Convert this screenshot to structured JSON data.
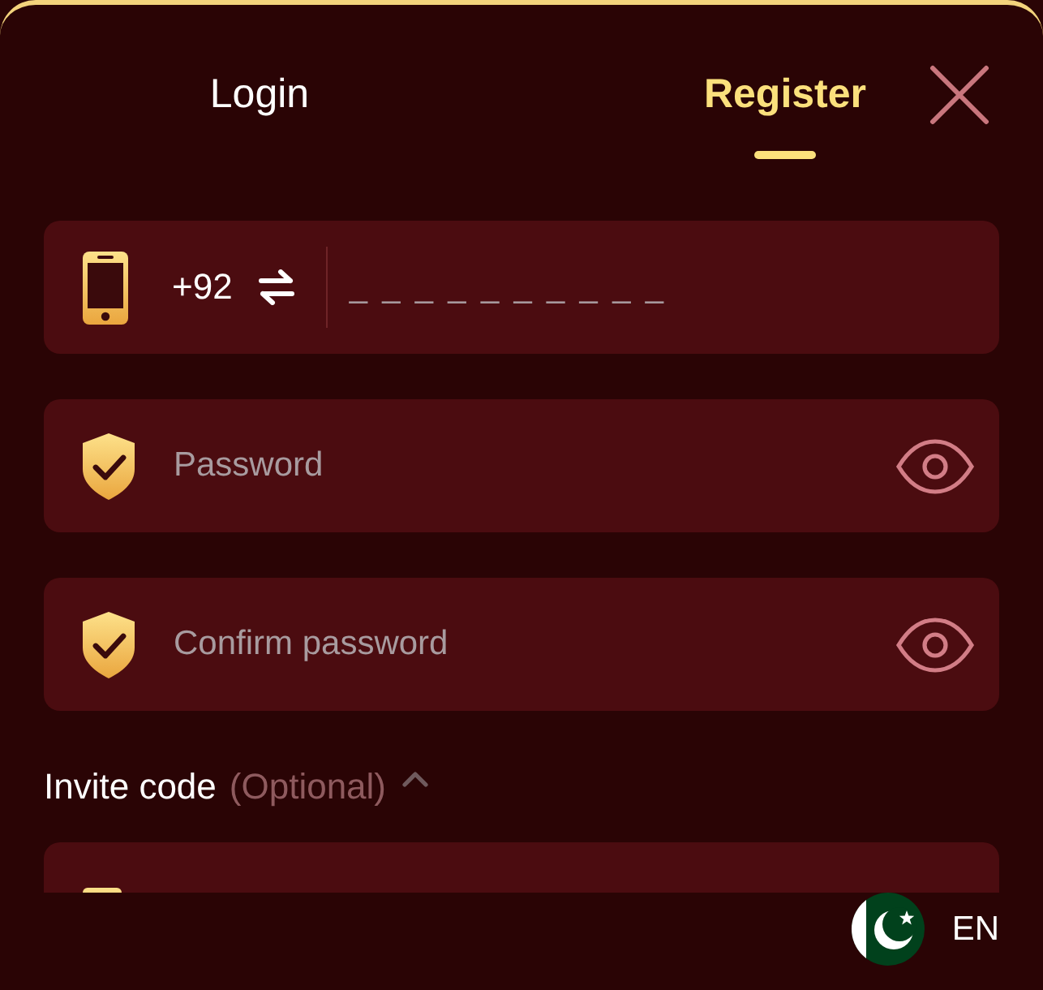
{
  "tabs": [
    {
      "label": "Login",
      "selected": false
    },
    {
      "label": "Register",
      "selected": true
    }
  ],
  "phone": {
    "country_code": "+92",
    "placeholder": "_ _ _ _ _ _ _ _ _ _"
  },
  "password_fields": [
    {
      "placeholder": "Password"
    },
    {
      "placeholder": "Confirm password"
    }
  ],
  "invite_code": {
    "label": "Invite code",
    "hint": "(Optional)",
    "expanded": true
  },
  "language": {
    "code": "EN"
  }
}
